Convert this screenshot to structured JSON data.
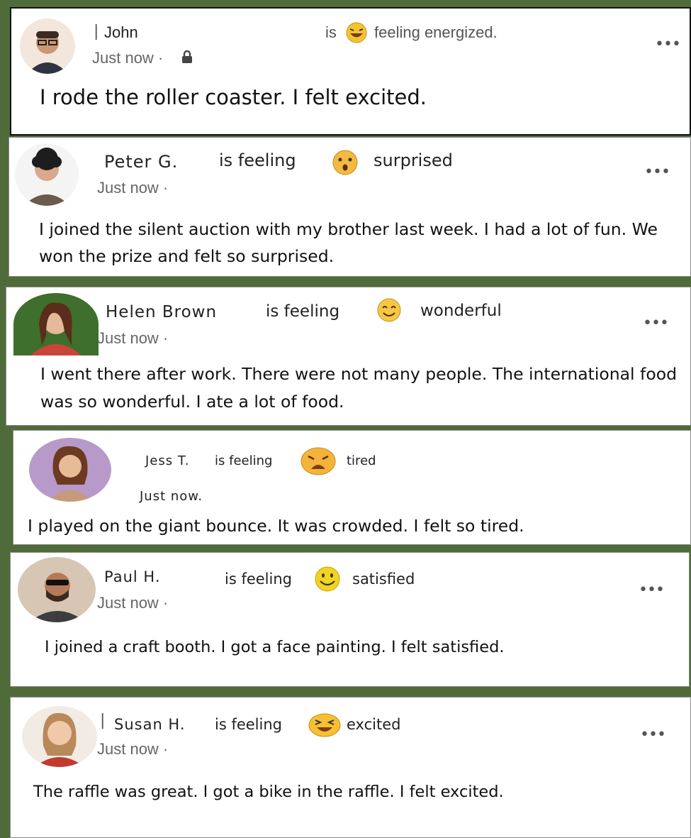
{
  "posts": [
    {
      "name": "John",
      "feeling_prefix": "is",
      "mood": "feeling energized.",
      "time": "Just now ·",
      "text": "I rode the roller coaster. I felt excited.",
      "emoji": "laughing-face-icon"
    },
    {
      "name": "Peter G.",
      "feeling_prefix": "is feeling",
      "mood": "surprised",
      "time": "Just now ·",
      "text": "I joined the silent auction with my brother last week. I had a lot of fun. We won the prize and felt so surprised.",
      "emoji": "surprised-face-icon"
    },
    {
      "name": "Helen Brown",
      "feeling_prefix": "is feeling",
      "mood": "wonderful",
      "time": "Just now ·",
      "text": "I went there after work. There were not many people. The international food was so wonderful. I ate a lot of food.",
      "emoji": "smiling-face-icon"
    },
    {
      "name": "Jess T.",
      "feeling_prefix": "is feeling",
      "mood": "tired",
      "time": "Just now.",
      "text": "I played on the giant bounce. It was crowded. I felt so tired.",
      "emoji": "tired-face-icon"
    },
    {
      "name": "Paul H.",
      "feeling_prefix": "is feeling",
      "mood": "satisfied",
      "time": "Just now ·",
      "text": "I joined a craft booth. I got a face painting. I felt satisfied.",
      "emoji": "satisfied-face-icon"
    },
    {
      "name": "Susan H.",
      "feeling_prefix": "is feeling",
      "mood": "excited",
      "time": "Just now ·",
      "text": "The raffle was great. I got a bike in the raffle. I felt excited.",
      "emoji": "excited-face-icon"
    }
  ],
  "more_label": "•••"
}
